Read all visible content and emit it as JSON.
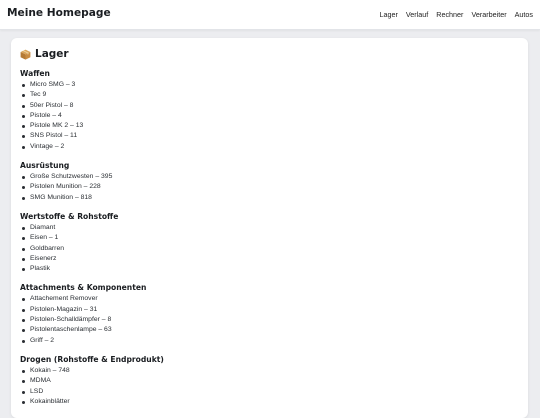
{
  "header": {
    "title": "Meine Homepage",
    "nav": [
      "Lager",
      "Verlauf",
      "Rechner",
      "Verarbeiter",
      "Autos"
    ]
  },
  "card": {
    "icon": "package-icon",
    "title": "Lager"
  },
  "sections": [
    {
      "title": "Waffen",
      "items": [
        "Micro SMG – 3",
        "Tec 9",
        "50er Pistol – 8",
        "Pistole – 4",
        "Pistole MK 2 – 13",
        "SNS Pistol – 11",
        "Vintage – 2"
      ]
    },
    {
      "title": "Ausrüstung",
      "items": [
        "Große Schutzwesten – 395",
        "Pistolen Munition – 228",
        "SMG Munition – 818"
      ]
    },
    {
      "title": "Wertstoffe & Rohstoffe",
      "items": [
        "Diamant",
        "Eisen – 1",
        "Goldbarren",
        "Eisenerz",
        "Plastik"
      ]
    },
    {
      "title": "Attachments & Komponenten",
      "items": [
        "Attachement Remover",
        "Pistolen-Magazin – 31",
        "Pistolen-Schalldämpfer – 8",
        "Pistolentaschenlampe – 63",
        "Griff – 2"
      ]
    },
    {
      "title": "Drogen (Rohstoffe & Endprodukt)",
      "items": [
        "Kokain – 748",
        "MDMA",
        "LSD",
        "Kokainblätter"
      ]
    }
  ],
  "colors": {
    "background": "#ecedf0",
    "card": "#ffffff",
    "text": "#1f2328"
  }
}
